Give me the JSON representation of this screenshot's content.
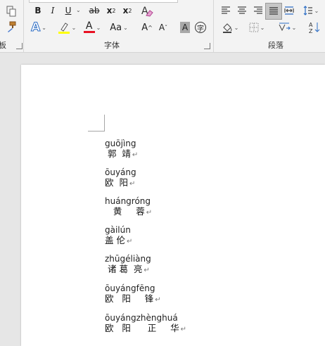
{
  "ribbon": {
    "font_group": {
      "label": "字体",
      "bold": "B",
      "italic": "I",
      "underline": "U",
      "strike": "ab",
      "subscript_base": "x",
      "subscript_mark": "2",
      "superscript_base": "x",
      "superscript_mark": "2",
      "text_effects": "A",
      "font_color": "A",
      "change_case": "Aa",
      "grow_font": "A",
      "shrink_font": "A",
      "char_shading": "A",
      "enclose_char": "字",
      "highlight_color": "#ffff00",
      "font_color_value": "#e81123"
    },
    "paragraph_group": {
      "label": "段落"
    },
    "clipboard_group": {
      "partial_label": "板"
    }
  },
  "document": {
    "entries": [
      {
        "pinyin": "guōjìng",
        "hanzi": " 郭  靖"
      },
      {
        "pinyin": "ōuyáng",
        "hanzi": "欧  阳"
      },
      {
        "pinyin": "huángróng",
        "hanzi": "   黄     蓉"
      },
      {
        "pinyin": "gàilún",
        "hanzi": "盖 伦"
      },
      {
        "pinyin": "zhūgéliàng",
        "hanzi": " 诸 葛  亮"
      },
      {
        "pinyin": "ōuyángfēng",
        "hanzi": "欧   阳     锋"
      },
      {
        "pinyin": "ōuyángzhènghuá",
        "hanzi": "欧   阳      正     华"
      }
    ],
    "paragraph_mark": "↵"
  }
}
